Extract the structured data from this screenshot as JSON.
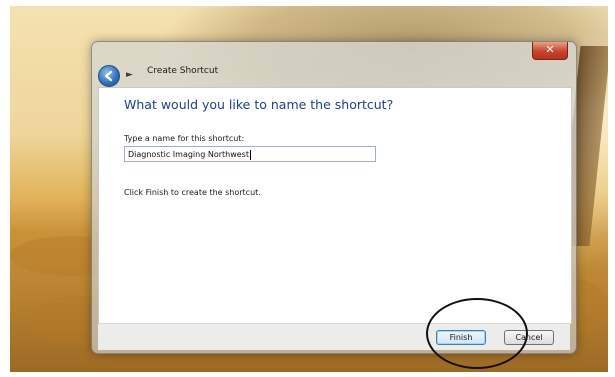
{
  "window": {
    "title": "Create Shortcut",
    "close_label": "✕",
    "forward_glyph": "►"
  },
  "content": {
    "heading": "What would you like to name the shortcut?",
    "name_label": "Type a name for this shortcut:",
    "name_value": "Diagnostic Imaging Northwest",
    "hint": "Click Finish to create the shortcut."
  },
  "footer": {
    "finish_label": "Finish",
    "cancel_label": "Cancel"
  },
  "icons": [
    "back-arrow-icon",
    "close-icon",
    "forward-arrow-icon"
  ],
  "colors": {
    "heading": "#1e3f8a",
    "close_button": "#c8442c",
    "annotation_circle": "#111111"
  }
}
